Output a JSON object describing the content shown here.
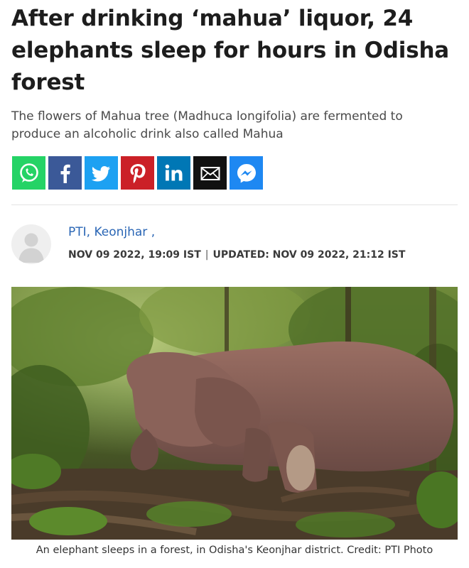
{
  "article": {
    "headline": "After drinking ‘mahua’ liquor, 24 elephants sleep for hours in Odisha forest",
    "subheadline": "The flowers of Mahua tree (Madhuca longifolia) are fermented to produce an alcoholic drink also called Mahua",
    "byline": {
      "author": "PTI, Keonjhar ,",
      "published": "NOV 09 2022, 19:09 IST",
      "separator": "|",
      "updated": "UPDATED: NOV 09 2022, 21:12 IST"
    },
    "image": {
      "caption": "An elephant sleeps in a forest, in Odisha's Keonjhar district. Credit: PTI Photo"
    }
  },
  "share": [
    {
      "name": "whatsapp-share-button",
      "icon": "whatsapp-icon",
      "color": "#25d366"
    },
    {
      "name": "facebook-share-button",
      "icon": "facebook-icon",
      "color": "#3b5998"
    },
    {
      "name": "twitter-share-button",
      "icon": "twitter-icon",
      "color": "#1da1f2"
    },
    {
      "name": "pinterest-share-button",
      "icon": "pinterest-icon",
      "color": "#cb2027"
    },
    {
      "name": "linkedin-share-button",
      "icon": "linkedin-icon",
      "color": "#0077b5"
    },
    {
      "name": "email-share-button",
      "icon": "email-icon",
      "color": "#111111"
    },
    {
      "name": "messenger-share-button",
      "icon": "messenger-icon",
      "color": "#1e88f2"
    }
  ],
  "colors": {
    "link": "#2a66b5",
    "headline": "#1d1d1d"
  }
}
